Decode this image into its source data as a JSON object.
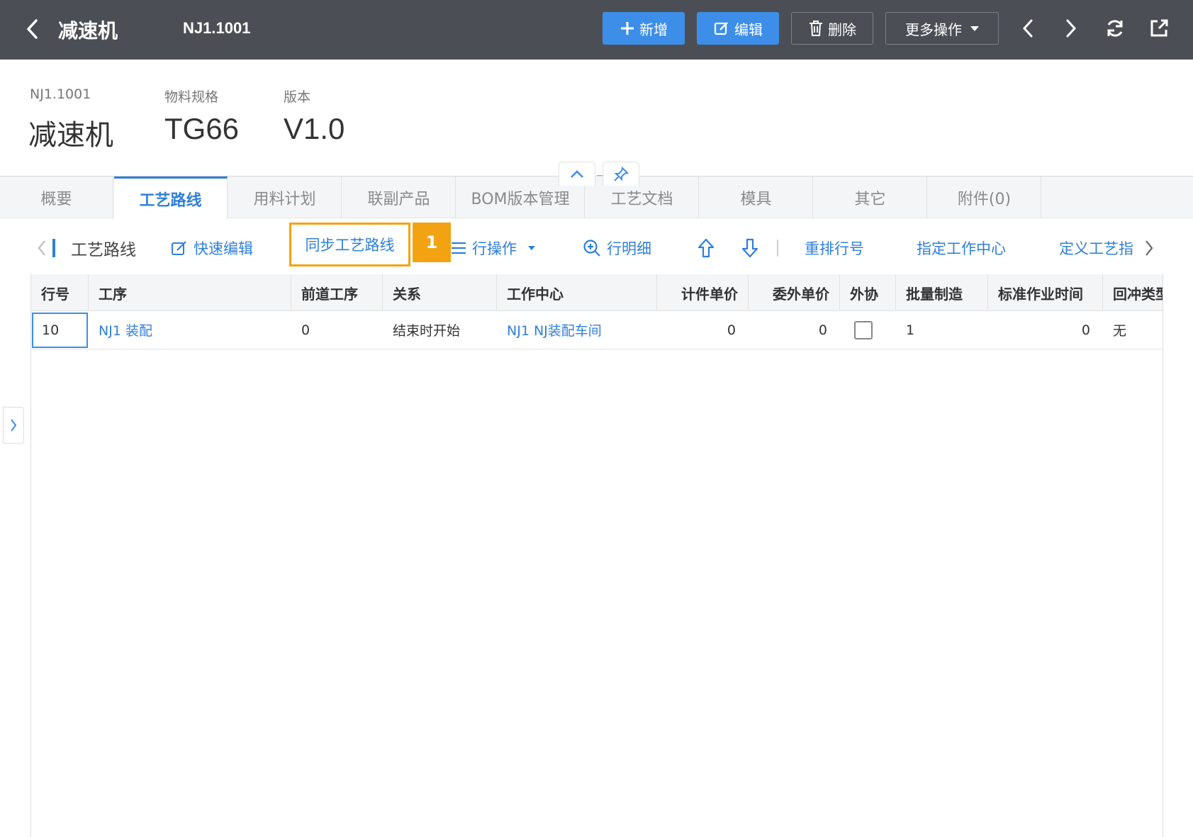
{
  "topbar": {
    "title": "减速机",
    "code": "NJ1.1001",
    "buttons": {
      "add": "新增",
      "edit": "编辑",
      "delete": "删除",
      "more": "更多操作"
    }
  },
  "header": {
    "fields": [
      {
        "label": "NJ1.1001",
        "value": "减速机"
      },
      {
        "label": "物料规格",
        "value": "TG66"
      },
      {
        "label": "版本",
        "value": "V1.0"
      }
    ]
  },
  "tabs": [
    "概要",
    "工艺路线",
    "用料计划",
    "联副产品",
    "BOM版本管理",
    "工艺文档",
    "模具",
    "其它",
    "附件(0)"
  ],
  "active_tab": "工艺路线",
  "toolbar": {
    "section_title": "工艺路线",
    "quick_edit": "快速编辑",
    "sync_route": "同步工艺路线",
    "badge": "1",
    "row_ops": "行操作",
    "row_detail": "行明细",
    "renumber": "重排行号",
    "assign_wc": "指定工作中心",
    "define_route": "定义工艺指"
  },
  "grid": {
    "columns": [
      "行号",
      "工序",
      "前道工序",
      "关系",
      "工作中心",
      "计件单价",
      "委外单价",
      "外协",
      "批量制造",
      "标准作业时间",
      "回冲类型"
    ],
    "rows": [
      {
        "line_no": "10",
        "process": "NJ1 装配",
        "prev_process": "0",
        "relation": "结束时开始",
        "work_center": "NJ1 NJ装配车间",
        "piece_price": "0",
        "outsource_price": "0",
        "outsourced": false,
        "batch": "1",
        "std_time": "0",
        "backflush": "无"
      }
    ]
  },
  "colors": {
    "topbar_bg": "#4b4f55",
    "primary": "#3d8ee8",
    "link": "#2f7fd8",
    "highlight": "#f3a311"
  }
}
